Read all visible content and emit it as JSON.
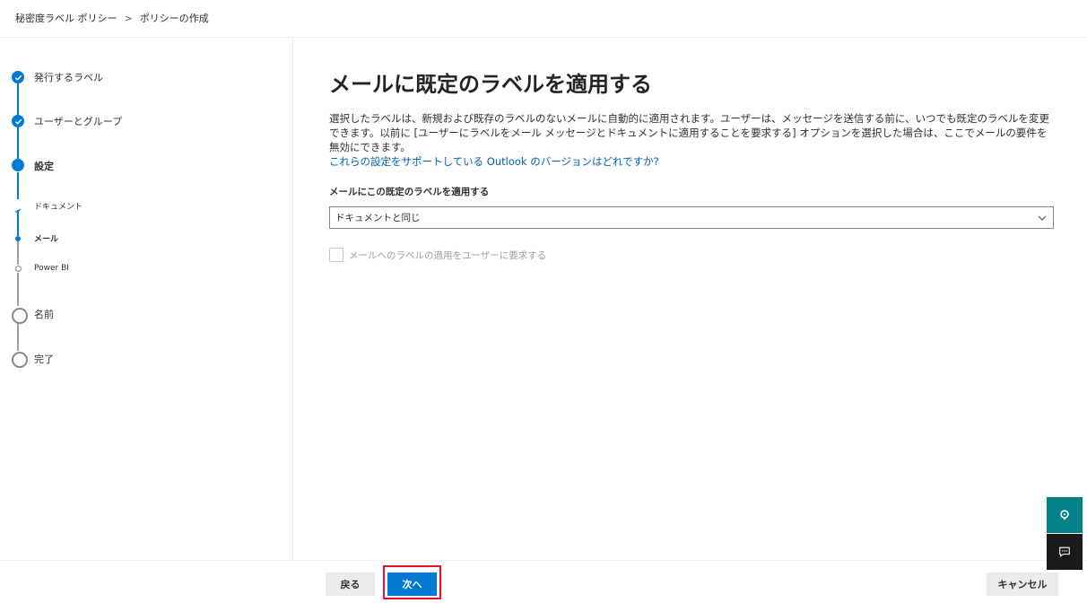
{
  "breadcrumb": {
    "parent": "秘密度ラベル ポリシー",
    "separator": ">",
    "current": "ポリシーの作成"
  },
  "steps": [
    {
      "label": "発行するラベル",
      "status": "completed"
    },
    {
      "label": "ユーザーとグループ",
      "status": "completed"
    },
    {
      "label": "設定",
      "status": "current"
    },
    {
      "label": "名前",
      "status": "not-started"
    },
    {
      "label": "完了",
      "status": "not-started"
    }
  ],
  "substeps": [
    {
      "label": "ドキュメント",
      "status": "completed"
    },
    {
      "label": "メール",
      "status": "current"
    },
    {
      "label": "Power BI",
      "status": "not-started"
    }
  ],
  "main": {
    "title": "メールに既定のラベルを適用する",
    "description": "選択したラベルは、新規および既存のラベルのないメールに自動的に適用されます。ユーザーは、メッセージを送信する前に、いつでも既定のラベルを変更できます。以前に [ユーザーにラベルをメール メッセージとドキュメントに適用することを要求する] オプションを選択した場合は、ここでメールの要件を無効にできます。",
    "link": "これらの設定をサポートしている Outlook のバージョンはどれですか?",
    "field_label": "メールにこの既定のラベルを適用する",
    "dropdown_value": "ドキュメントと同じ",
    "checkbox_label": "メールへのラベルの適用をユーザーに要求する",
    "checkbox_checked": false
  },
  "footer": {
    "back_label": "戻る",
    "next_label": "次へ",
    "cancel_label": "キャンセル"
  },
  "side_buttons": [
    {
      "icon": "help-chat-icon"
    },
    {
      "icon": "feedback-icon"
    }
  ],
  "colors": {
    "accent": "#0078d4",
    "highlight_border": "#e81123",
    "teal": "#038387"
  }
}
